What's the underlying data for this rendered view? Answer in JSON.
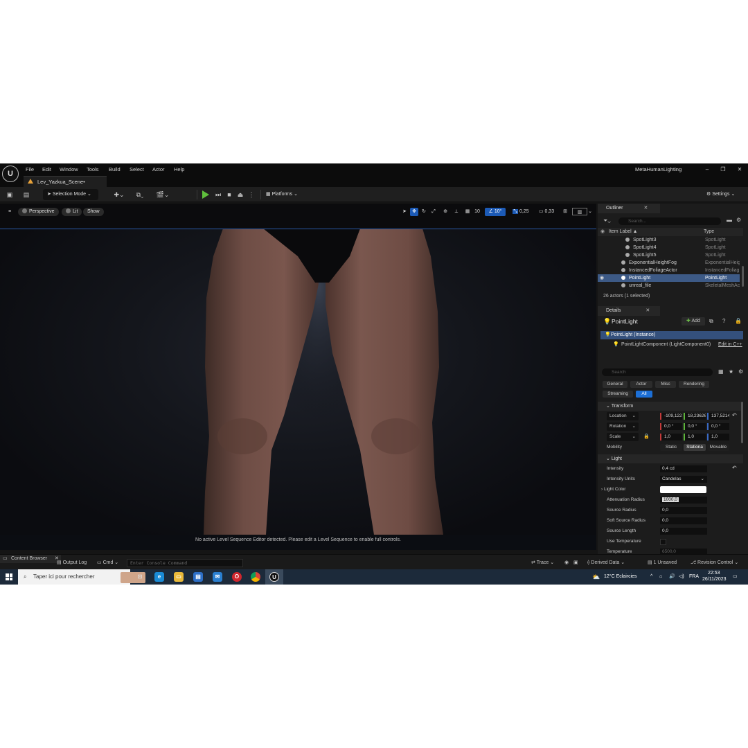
{
  "titlebar": {
    "menus": [
      "File",
      "Edit",
      "Window",
      "Tools",
      "Build",
      "Select",
      "Actor",
      "Help"
    ],
    "project_name": "MetaHumanLighting",
    "level_tab": "Lev_Yazkua_Scene•"
  },
  "toolbar": {
    "selection_mode": "Selection Mode",
    "platforms": "Platforms",
    "settings": "Settings"
  },
  "viewport": {
    "perspective": "Perspective",
    "lit": "Lit",
    "show": "Show",
    "grid_snap": "10",
    "rotation_snap": "10°",
    "scale_snap": "0,25",
    "camera_speed": "0,33",
    "sequence_message": "No active Level Sequence Editor detected. Please edit a Level Sequence to enable full controls."
  },
  "outliner": {
    "tab": "Outliner",
    "search_placeholder": "Search...",
    "col_label": "Item Label ▲",
    "col_type": "Type",
    "rows": [
      {
        "label": "SpotLight3",
        "type": "SpotLight"
      },
      {
        "label": "SpotLight4",
        "type": "SpotLight"
      },
      {
        "label": "SpotLight5",
        "type": "SpotLight"
      },
      {
        "label": "ExponentialHeightFog",
        "type": "ExponentialHeig"
      },
      {
        "label": "InstancedFoliageActor",
        "type": "InstancedFoliag"
      },
      {
        "label": "PointLight",
        "type": "PointLight"
      },
      {
        "label": "unreal_file",
        "type": "SkeletalMeshAc"
      }
    ],
    "status": "26 actors (1 selected)"
  },
  "details": {
    "tab": "Details",
    "actor_name": "PointLight",
    "add_label": "Add",
    "instance": "PointLight (Instance)",
    "component": "PointLightComponent (LightComponent0)",
    "edit_cpp": "Edit in C++",
    "search_placeholder": "Search",
    "categories": [
      "General",
      "Actor",
      "Misc",
      "Rendering",
      "Streaming",
      "All"
    ],
    "transform_header": "Transform",
    "location_label": "Location",
    "location": [
      "-109,122",
      "18,23626",
      "137,5214"
    ],
    "rotation_label": "Rotation",
    "rotation": [
      "0,0 °",
      "0,0 °",
      "0,0 °"
    ],
    "scale_label": "Scale",
    "scale": [
      "1,0",
      "1,0",
      "1,0"
    ],
    "mobility_label": "Mobility",
    "mobility_options": [
      "Static",
      "Stationa",
      "Movable"
    ],
    "light_header": "Light",
    "intensity_label": "Intensity",
    "intensity": "0,4 cd",
    "intensity_units_label": "Intensity Units",
    "intensity_units": "Candelas",
    "light_color_label": "Light Color",
    "light_color": "#ffffff",
    "attenuation_label": "Attenuation Radius",
    "attenuation": "1000,0",
    "source_radius_label": "Source Radius",
    "source_radius": "0,0",
    "soft_source_label": "Soft Source Radius",
    "soft_source": "0,0",
    "source_length_label": "Source Length",
    "source_length": "0,0",
    "use_temp_label": "Use Temperature",
    "temperature_label": "Temperature",
    "temperature": "6500,0"
  },
  "statusbar": {
    "content_browser": "Content Browser",
    "output_log": "Output Log",
    "cmd": "Cmd",
    "console_placeholder": "Enter Console Command",
    "trace": "Trace",
    "derived_data": "Derived Data",
    "unsaved": "1 Unsaved",
    "revision_control": "Revision Control"
  },
  "taskbar": {
    "search_text": "Taper ici pour rechercher",
    "weather": "12°C  Eclaircies",
    "lang": "FRA",
    "time": "22:53",
    "date": "26/11/2023"
  }
}
